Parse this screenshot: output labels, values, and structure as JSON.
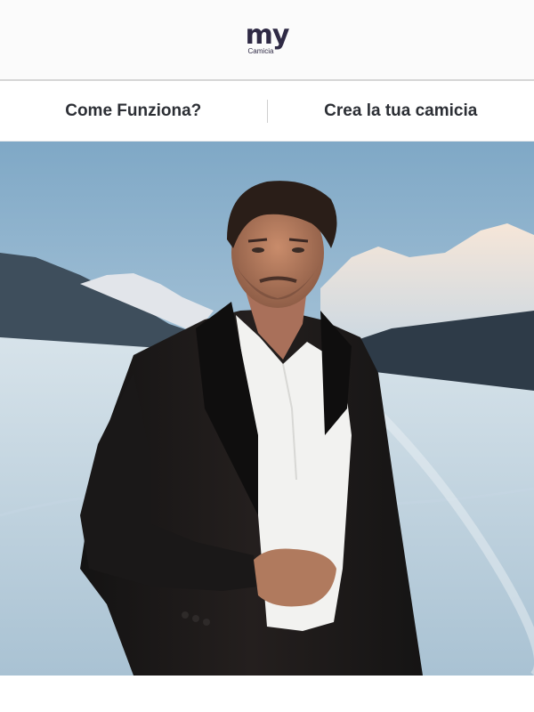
{
  "header": {
    "logo_text": "my",
    "logo_sub": "Camicia"
  },
  "nav": {
    "items": [
      {
        "label": "Come Funziona?"
      },
      {
        "label": "Crea la tua camicia"
      }
    ]
  },
  "hero": {
    "image_alt": "Man in dark coat and white shirt standing in a snowy mountain landscape",
    "colors": {
      "sky": "#9cbbd2",
      "snow": "#dfe9ef",
      "coat": "#1c1a1a",
      "shirt": "#f4f4f2",
      "skin": "#b47a5c"
    }
  }
}
